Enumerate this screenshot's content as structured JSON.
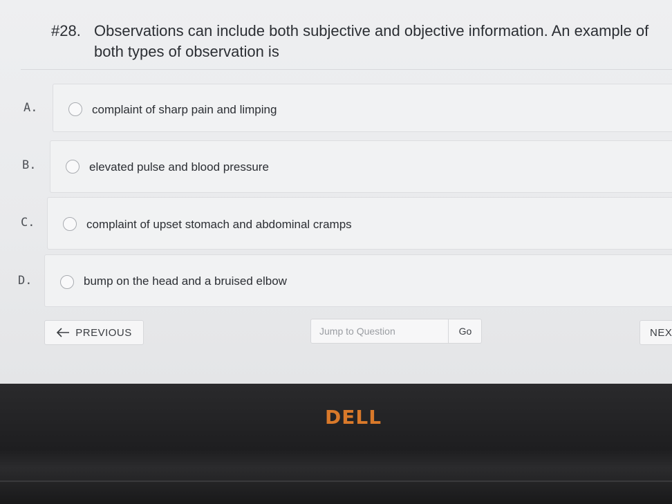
{
  "question": {
    "number": "#28.",
    "text": "Observations can include both subjective and objective information. An example of both types of observation is"
  },
  "options": [
    {
      "letter": "A.",
      "text": "complaint of sharp pain and limping"
    },
    {
      "letter": "B.",
      "text": "elevated pulse and blood pressure"
    },
    {
      "letter": "C.",
      "text": "complaint of upset stomach and abdominal cramps"
    },
    {
      "letter": "D.",
      "text": "bump on the head and a bruised elbow"
    }
  ],
  "nav": {
    "previous_label": "PREVIOUS",
    "jump_placeholder": "Jump to Question",
    "go_label": "Go",
    "next_label": "NEXT"
  },
  "bezel": {
    "logo": "DELL"
  },
  "colors": {
    "logo": "#d9792a"
  }
}
